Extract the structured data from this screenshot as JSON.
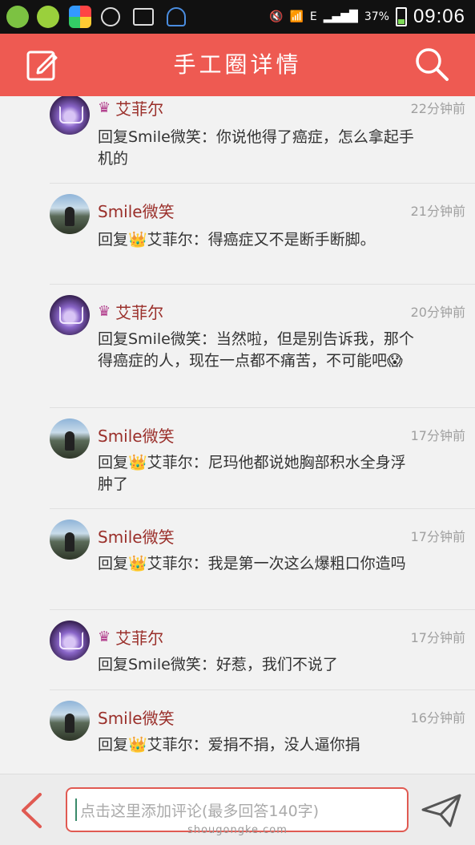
{
  "status_bar": {
    "signal_label": "E",
    "battery_text": "37%",
    "time": "09:06",
    "icons": [
      "plus-app-icon",
      "music-app-icon",
      "colorful-app-icon",
      "face-icon",
      "image-icon",
      "headset-icon",
      "mute-icon",
      "wifi-icon",
      "signal-icon",
      "battery-icon"
    ]
  },
  "header": {
    "title": "手工圈详情",
    "left_icon": "edit-icon",
    "right_icon": "search-icon",
    "background": "#ee5a52"
  },
  "comments": [
    {
      "name": "艾菲尔",
      "has_crown": true,
      "avatar": "crown",
      "time": "22分钟前",
      "text": "回复Smile微笑：你说他得了癌症，怎么拿起手机的"
    },
    {
      "name": "Smile微笑",
      "has_crown": false,
      "avatar": "photo",
      "time": "21分钟前",
      "text": "回复👑艾菲尔：得癌症又不是断手断脚。"
    },
    {
      "name": "艾菲尔",
      "has_crown": true,
      "avatar": "crown",
      "time": "20分钟前",
      "text": "回复Smile微笑：当然啦，但是别告诉我，那个得癌症的人，现在一点都不痛苦，不可能吧😱"
    },
    {
      "name": "Smile微笑",
      "has_crown": false,
      "avatar": "photo",
      "time": "17分钟前",
      "text": "回复👑艾菲尔：尼玛他都说她胸部积水全身浮肿了"
    },
    {
      "name": "Smile微笑",
      "has_crown": false,
      "avatar": "photo",
      "time": "17分钟前",
      "text": "回复👑艾菲尔：我是第一次这么爆粗口你造吗"
    },
    {
      "name": "艾菲尔",
      "has_crown": true,
      "avatar": "crown",
      "time": "17分钟前",
      "text": "回复Smile微笑：好惹，我们不说了"
    },
    {
      "name": "Smile微笑",
      "has_crown": false,
      "avatar": "photo",
      "time": "16分钟前",
      "text": "回复👑艾菲尔：爱捐不捐，没人逼你捐"
    }
  ],
  "bottom": {
    "placeholder": "点击这里添加评论(最多回答140字)",
    "watermark": "shougongke.com",
    "left_icon": "back-arrow-icon",
    "right_icon": "send-icon"
  }
}
